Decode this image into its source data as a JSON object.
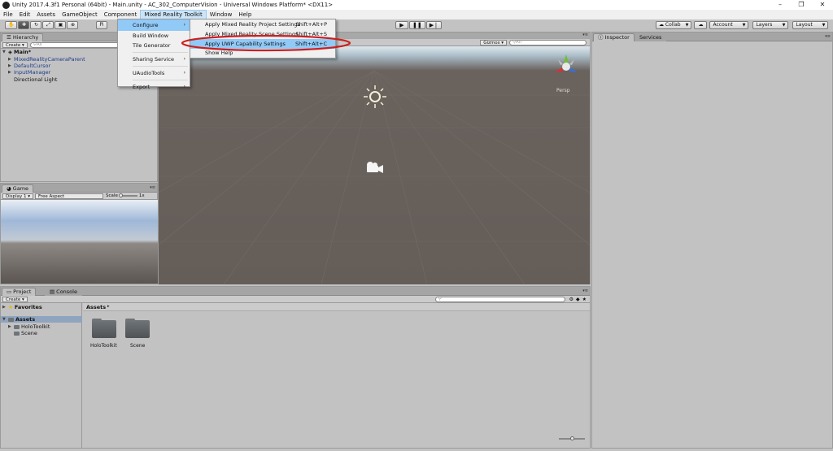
{
  "window": {
    "title": "Unity 2017.4.3f1 Personal (64bit) - Main.unity - AC_302_ComputerVision - Universal Windows Platform* <DX11>",
    "minimize": "–",
    "maximize": "❐",
    "close": "✕"
  },
  "menubar": {
    "items": [
      "File",
      "Edit",
      "Assets",
      "GameObject",
      "Component",
      "Mixed Reality Toolkit",
      "Window",
      "Help"
    ]
  },
  "toolbar": {
    "pivot_label": "Pi",
    "collab_label": "Collab",
    "account_label": "Account",
    "layers_label": "Layers",
    "layout_label": "Layout"
  },
  "hierarchy": {
    "tab": "Hierarchy",
    "create_label": "Create",
    "search_placeholder": "All",
    "scene_name": "Main*",
    "items": [
      "MixedRealityCameraParent",
      "DefaultCursor",
      "InputManager",
      "Directional Light"
    ]
  },
  "game": {
    "tab": "Game",
    "display_label": "Display 1",
    "aspect_label": "Free Aspect",
    "scale_label": "Scale",
    "scale_value": "1x"
  },
  "scene": {
    "gizmos_label": "Gizmos",
    "search_placeholder": "All",
    "persp_label": "Persp"
  },
  "project": {
    "tab_project": "Project",
    "tab_console": "Console",
    "create_label": "Create",
    "favorites_label": "Favorites",
    "assets_label": "Assets",
    "breadcrumb": "Assets",
    "tree_items": [
      "HoloToolkit",
      "Scene"
    ],
    "grid_items": [
      "HoloToolkit",
      "Scene"
    ]
  },
  "inspector": {
    "tab_inspector": "Inspector",
    "tab_services": "Services"
  },
  "menu_mrtk": {
    "items": [
      "Configure",
      "Build Window",
      "Tile Generator",
      "Sharing Service",
      "UAudioTools",
      "Export"
    ]
  },
  "menu_configure": {
    "items": [
      {
        "label": "Apply Mixed Reality Project Settings",
        "shortcut": "Shift+Alt+P"
      },
      {
        "label": "Apply Mixed Reality Scene Settings",
        "shortcut": "Shift+Alt+S"
      },
      {
        "label": "Apply UWP Capability Settings",
        "shortcut": "Shift+Alt+C"
      },
      {
        "label": "Show Help",
        "shortcut": ""
      }
    ]
  },
  "colors": {
    "highlight": "#91c9f7",
    "annotation_circle": "#cc1f1f",
    "gizmo_x": "#d33333",
    "gizmo_y": "#6cbf3b",
    "gizmo_z": "#3b6fd0"
  }
}
